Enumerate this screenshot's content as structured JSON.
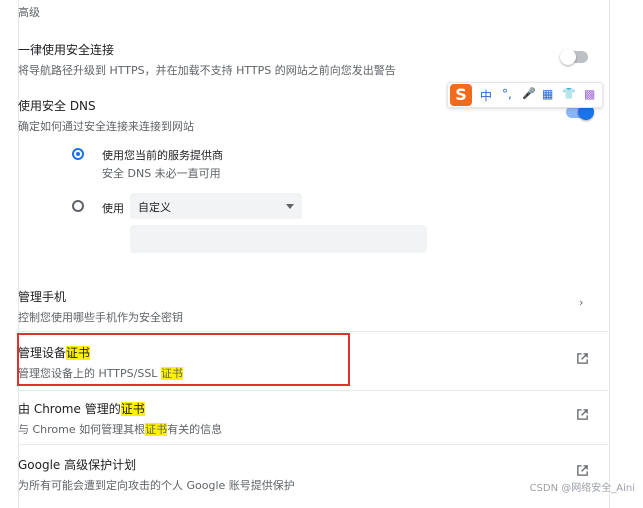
{
  "section_label": "高级",
  "secure_connection": {
    "title": "一律使用安全连接",
    "subtitle": "将导航路径升级到 HTTPS，并在加载不支持 HTTPS 的网站之前向您发出警告",
    "enabled": false
  },
  "secure_dns": {
    "title": "使用安全 DNS",
    "subtitle": "确定如何通过安全连接来连接到网站",
    "enabled": true,
    "option_current": {
      "label": "使用您当前的服务提供商",
      "sub": "安全 DNS 未必一直可用",
      "selected": true
    },
    "option_custom": {
      "label": "使用",
      "selected": false,
      "select_value": "自定义",
      "input_value": ""
    }
  },
  "manage_phone": {
    "title": "管理手机",
    "subtitle": "控制您使用哪些手机作为安全密钥"
  },
  "manage_certs": {
    "title_a": "管理设备",
    "title_hl": "证书",
    "sub_a": "管理您设备上的 HTTPS/SSL ",
    "sub_hl": "证书"
  },
  "chrome_certs": {
    "title_a": "由 Chrome 管理的",
    "title_hl": "证书",
    "sub_a": "与 Chrome 如何管理其根",
    "sub_hl": "证书",
    "sub_b": "有关的信息"
  },
  "advanced_protection": {
    "title": "Google 高级保护计划",
    "subtitle": "为所有可能会遭到定向攻击的个人 Google 账号提供保护"
  },
  "ime_toolbar": {
    "logo": "S",
    "items": [
      "中",
      "°,",
      "🎤",
      "▦",
      "👕",
      "▩"
    ]
  },
  "watermark": "CSDN @网络安全_Aini",
  "colors": {
    "accent": "#1a73e8",
    "highlight": "#fff200",
    "annotation_box": "#e03030"
  }
}
